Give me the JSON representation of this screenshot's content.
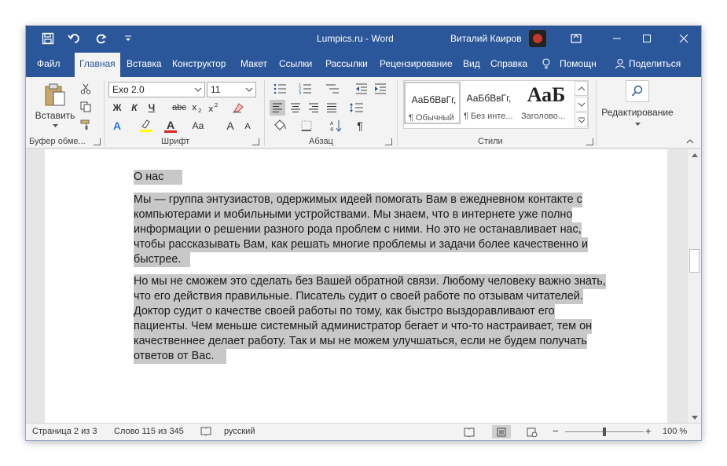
{
  "window": {
    "doc_title": "Lumpics.ru  -  Word",
    "user": "Виталий Каиров"
  },
  "tabs": [
    {
      "label": "Файл"
    },
    {
      "label": "Главная"
    },
    {
      "label": "Вставка"
    },
    {
      "label": "Конструктор"
    },
    {
      "label": "Макет"
    },
    {
      "label": "Ссылки"
    },
    {
      "label": "Рассылки"
    },
    {
      "label": "Рецензирование"
    },
    {
      "label": "Вид"
    },
    {
      "label": "Справка"
    },
    {
      "label": "Помощн"
    },
    {
      "label": "Поделиться"
    }
  ],
  "ribbon": {
    "paste_label": "Вставить",
    "font_name": "Exo 2.0",
    "font_size": "11",
    "bold": "Ж",
    "italic": "К",
    "underline": "Ч",
    "strike": "abc",
    "grow_font": "A",
    "shrink_font": "A",
    "change_case": "Aa",
    "text_effect": "A",
    "font_color_letter": "A",
    "pilcrow": "¶",
    "editing_label": "Редактирование",
    "groups": {
      "clipboard": "Буфер обме...",
      "font": "Шрифт",
      "paragraph": "Абзац",
      "styles": "Стили"
    },
    "styles": [
      {
        "sample": "АаБбВвГг,",
        "name": "¶ Обычный"
      },
      {
        "sample": "АаБбВвГг,",
        "name": "¶ Без инте..."
      },
      {
        "sample": "АаБ",
        "name": "Заголово..."
      }
    ]
  },
  "document": {
    "heading": "О нас",
    "paragraph1_lines": [
      "Мы — группа энтузиастов, одержимых идеей помогать Вам в ежедневном контакте с",
      "компьютерами и мобильными устройствами. Мы знаем, что в интернете уже полно",
      "информации о решении разного рода проблем с ними. Но это не останавливает нас,",
      "чтобы рассказывать Вам, как решать многие проблемы и задачи более качественно и",
      "быстрее."
    ],
    "paragraph2_lines": [
      "Но мы не сможем это сделать без Вашей обратной связи. Любому человеку важно знать,",
      "что его действия правильные. Писатель судит о своей работе по отзывам читателей.",
      "Доктор судит о качестве своей работы по тому, как быстро выздоравливают его",
      "пациенты. Чем меньше системный администратор бегает и что-то настраивает, тем он",
      "качественнее делает работу. Так и мы не можем улучшаться, если не будем получать",
      "ответов от Вас."
    ]
  },
  "status": {
    "page": "Страница 2 из 3",
    "words": "Слово 115 из 345",
    "language": "русский",
    "zoom_minus": "−",
    "zoom_plus": "+",
    "zoom": "100 %",
    "zoom_level_fraction": 0.5
  },
  "colors": {
    "accent": "#2b579a",
    "selection": "#c8c8c8"
  },
  "icons": [
    "save-icon",
    "undo-icon",
    "redo-icon",
    "customize-icon",
    "ribbon-display-icon",
    "minimize-icon",
    "maximize-icon",
    "close-icon",
    "lightbulb-icon",
    "person-icon",
    "paste-icon",
    "cut-icon",
    "copy-icon",
    "format-painter-icon",
    "search-icon",
    "read-mode-icon",
    "print-layout-icon",
    "web-layout-icon",
    "scroll-up-icon",
    "scroll-down-icon"
  ]
}
